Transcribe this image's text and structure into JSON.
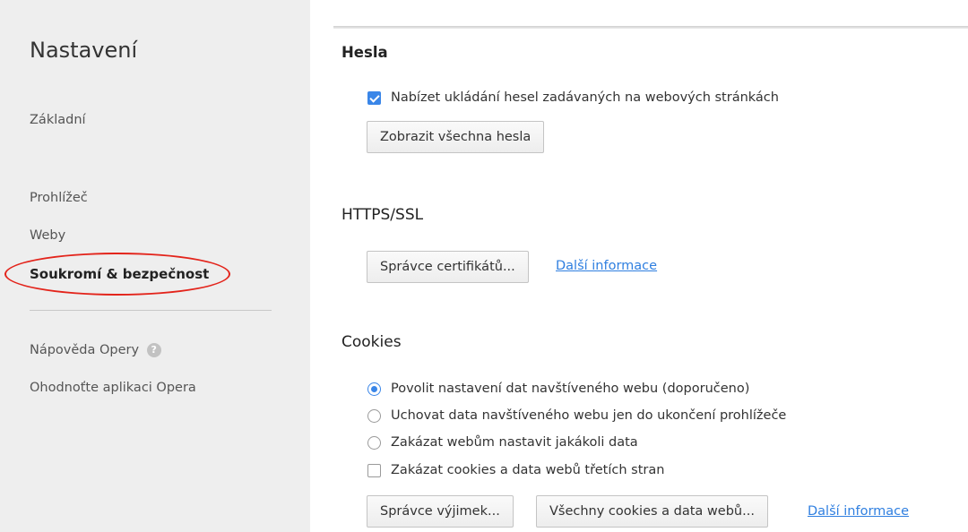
{
  "sidebar": {
    "title": "Nastavení",
    "items": [
      {
        "label": "Základní"
      },
      {
        "label": "Prohlížeč"
      },
      {
        "label": "Weby"
      },
      {
        "label": "Soukromí & bezpečnost",
        "active": true
      }
    ],
    "footer": [
      {
        "label": "Nápověda Opery"
      },
      {
        "label": "Ohodnoťte aplikaci Opera"
      }
    ],
    "help_glyph": "?"
  },
  "passwords": {
    "title": "Hesla",
    "offer_save_label": "Nabízet ukládání hesel zadávaných na webových stránkách",
    "offer_save_checked": true,
    "show_all_button": "Zobrazit všechna hesla"
  },
  "https": {
    "title": "HTTPS/SSL",
    "cert_manager_button": "Správce certifikátů...",
    "more_info_link": "Další informace"
  },
  "cookies": {
    "title": "Cookies",
    "options": [
      {
        "label": "Povolit nastavení dat navštíveného webu (doporučeno)",
        "selected": true
      },
      {
        "label": "Uchovat data navštíveného webu jen do ukončení prohlížeče",
        "selected": false
      },
      {
        "label": "Zakázat webům nastavit jakákoli data",
        "selected": false
      }
    ],
    "block_third_party_label": "Zakázat cookies a data webů třetích stran",
    "block_third_party_checked": false,
    "exceptions_button": "Správce výjimek...",
    "all_cookies_button": "Všechny cookies a data webů...",
    "more_info_link": "Další informace"
  },
  "colors": {
    "accent": "#3a86e8",
    "link": "#2f7fe0",
    "annotation": "#e3241b",
    "sidebar_bg": "#eeeeee"
  }
}
